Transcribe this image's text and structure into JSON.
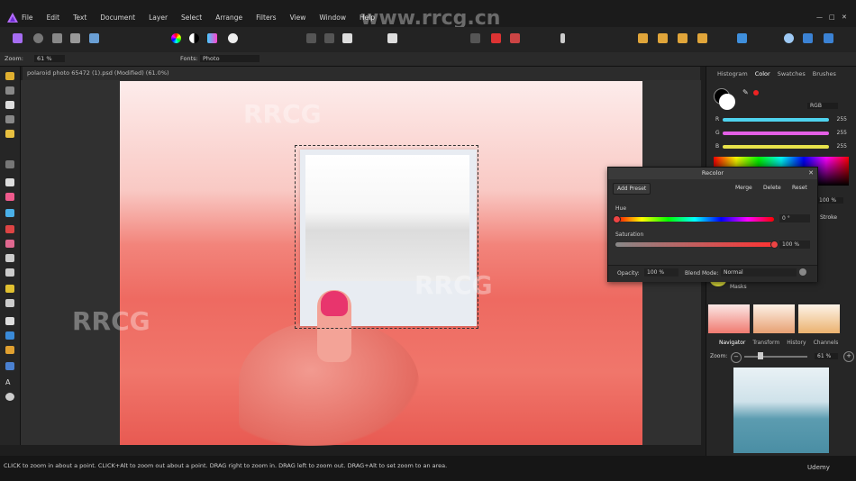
{
  "menu": [
    "File",
    "Edit",
    "Text",
    "Document",
    "Layer",
    "Select",
    "Arrange",
    "Filters",
    "View",
    "Window",
    "Help"
  ],
  "watermark": "www.rrcg.cn",
  "context": {
    "zoom_label": "Zoom:",
    "zoom_value": "61 %",
    "fonts_label": "Fonts:",
    "fonts_value": "Photo"
  },
  "document": {
    "tab_title": "polaroid photo 65472 (1).psd (Modified) (61.0%)"
  },
  "colors_panel": {
    "tabs": [
      "Histogram",
      "Color",
      "Swatches",
      "Brushes"
    ],
    "active_tab": "Color",
    "mode": "RGB",
    "channels": [
      {
        "label": "R",
        "value": "255",
        "color": "#4fd3ee"
      },
      {
        "label": "G",
        "value": "255",
        "color": "#e35fe5"
      },
      {
        "label": "B",
        "value": "255",
        "color": "#e7e24a"
      }
    ],
    "opacity_value": "100 %",
    "stroke_label": "Stroke"
  },
  "recolor": {
    "title": "Recolor",
    "add_preset": "Add Preset",
    "merge": "Merge",
    "delete": "Delete",
    "reset": "Reset",
    "hue_label": "Hue",
    "hue_value": "0 °",
    "hue_fraction": 0.0,
    "saturation_label": "Saturation",
    "saturation_value": "100 %",
    "saturation_fraction": 1.0,
    "opacity_label": "Opacity:",
    "opacity_value": "100 %",
    "blend_label": "Blend Mode:",
    "blend_value": "Normal"
  },
  "layers_panel": {
    "partial_label": "Masks",
    "badge": "fx"
  },
  "nav_panel": {
    "tabs": [
      "Navigator",
      "Transform",
      "History",
      "Channels"
    ],
    "active_tab": "Navigator",
    "zoom_label": "Zoom:",
    "zoom_value": "61 %"
  },
  "status": {
    "text": "CLICK to zoom in about a point. CLICK+Alt to zoom out about a point. DRAG right to zoom in. DRAG left to zoom out. DRAG+Alt to set zoom to an area."
  },
  "brand": {
    "udemy": "Udemy"
  }
}
